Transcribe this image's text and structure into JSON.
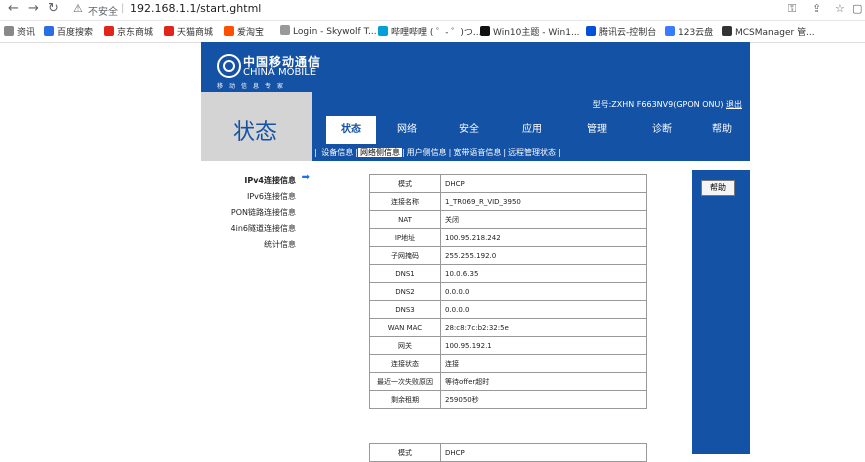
{
  "browser": {
    "insecure_label": "不安全",
    "url": "192.168.1.1/start.ghtml",
    "bookmarks": [
      "资讯",
      "百度搜索",
      "京东商城",
      "天猫商城",
      "爱淘宝",
      "Login - Skywolf T...",
      "哔哩哔哩 ( ゜- ゜)つ...",
      "Win10主题 - Win1...",
      "腾讯云-控制台",
      "123云盘",
      "MCSManager 管..."
    ],
    "bookmark_colors": [
      "#888888",
      "#2b6de5",
      "#e1251b",
      "#e1251b",
      "#ff5000",
      "#999999",
      "#00a1d6",
      "#111111",
      "#0052d9",
      "#3a7bff",
      "#333333"
    ]
  },
  "header": {
    "logo_cn": "中国移动通信",
    "logo_en": "CHINA MOBILE",
    "slogan": "移动信息专家",
    "model_label": "型号:",
    "model_value": "ZXHN F663NV9(GPON ONU)",
    "logout": "退出",
    "section_title": "状态"
  },
  "tabs": [
    "状态",
    "网络",
    "安全",
    "应用",
    "管理",
    "诊断",
    "帮助"
  ],
  "subtabs": [
    "设备信息",
    "网络侧信息",
    "用户侧信息",
    "宽带语音信息",
    "远程管理状态"
  ],
  "left_menu": [
    "IPv4连接信息",
    "IPv6连接信息",
    "PON链路连接信息",
    "4in6隧道连接信息",
    "统计信息"
  ],
  "help_button": "帮助",
  "connection_table": [
    {
      "k": "模式",
      "v": "DHCP"
    },
    {
      "k": "连接名称",
      "v": "1_TR069_R_VID_3950"
    },
    {
      "k": "NAT",
      "v": "关闭"
    },
    {
      "k": "IP地址",
      "v": "100.95.218.242"
    },
    {
      "k": "子网掩码",
      "v": "255.255.192.0"
    },
    {
      "k": "DNS1",
      "v": "10.0.6.35"
    },
    {
      "k": "DNS2",
      "v": "0.0.0.0"
    },
    {
      "k": "DNS3",
      "v": "0.0.0.0"
    },
    {
      "k": "WAN MAC",
      "v": "28:c8:7c:b2:32:5e"
    },
    {
      "k": "网关",
      "v": "100.95.192.1"
    },
    {
      "k": "连接状态",
      "v": "连接"
    },
    {
      "k": "最近一次失败原因",
      "v": "等待offer超时"
    },
    {
      "k": "剩余租期",
      "v": "259050秒"
    }
  ],
  "second_table": [
    {
      "k": "模式",
      "v": "DHCP"
    }
  ]
}
